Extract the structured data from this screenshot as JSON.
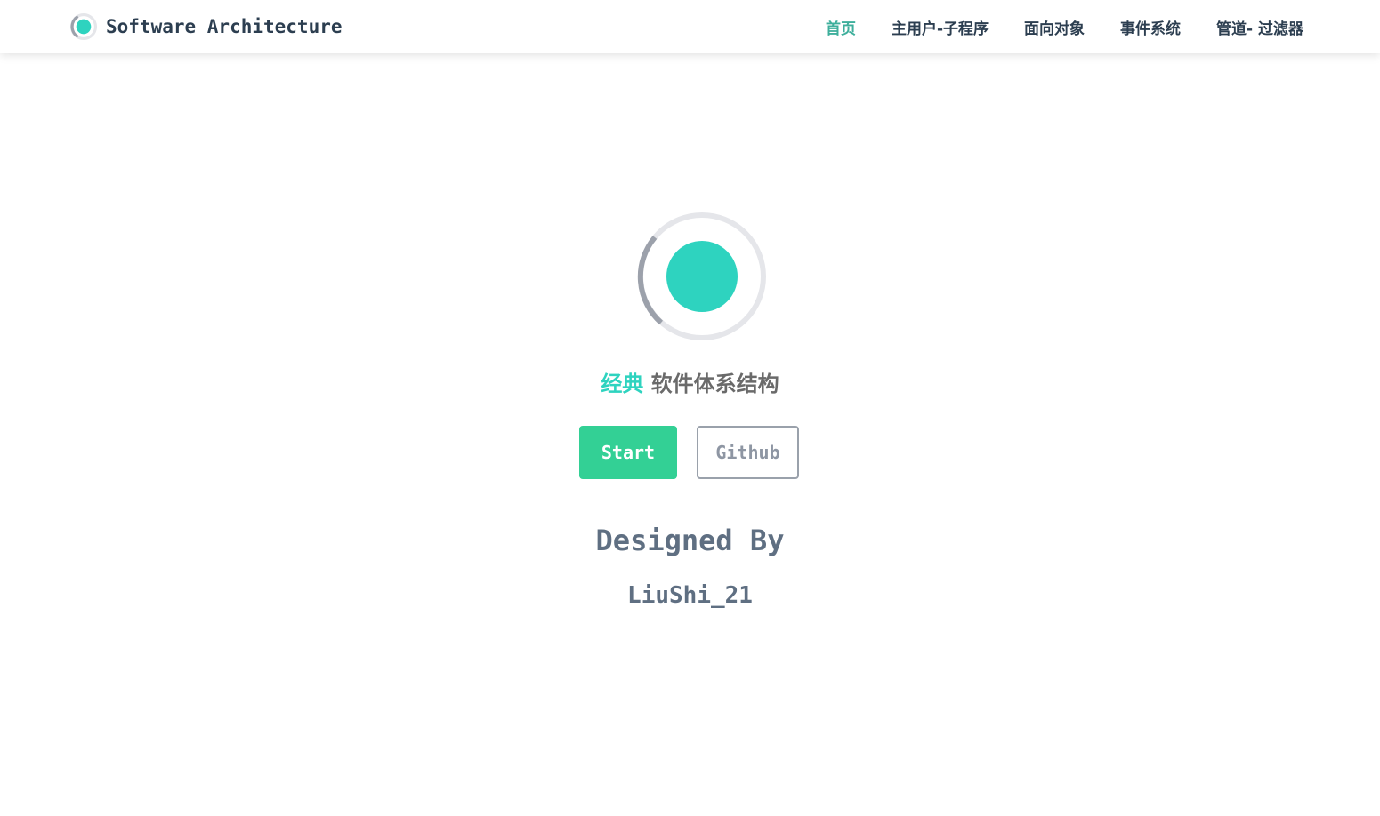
{
  "navbar": {
    "brand_title": "Software Architecture",
    "logo_icon": "ring-dot-logo-icon",
    "links": [
      {
        "label": "首页",
        "active": true
      },
      {
        "label": "主用户-子程序",
        "active": false
      },
      {
        "label": "面向对象",
        "active": false
      },
      {
        "label": "事件系统",
        "active": false
      },
      {
        "label": "管道- 过滤器",
        "active": false
      }
    ]
  },
  "hero": {
    "logo_icon": "ring-dot-logo-icon",
    "tagline_accent": "经典",
    "tagline_rest": " 软件体系结构",
    "start_label": "Start",
    "github_label": "Github",
    "designed_by": "Designed By",
    "author": "LiuShi_21"
  },
  "colors": {
    "accent_teal": "#2ed3bf",
    "active_link": "#3eaf9c",
    "start_button": "#33d095",
    "ring_light": "#e5e6ea",
    "ring_dark": "#9ca1ab",
    "text_dark": "#2c3e50",
    "text_slate": "#5f6f82"
  }
}
